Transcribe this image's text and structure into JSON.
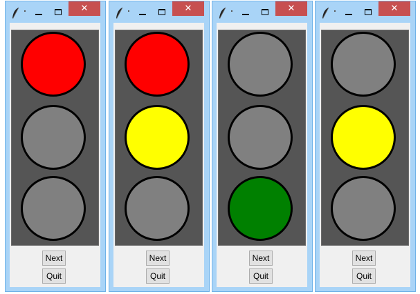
{
  "windows": [
    {
      "close_glyph": "✕",
      "lamps": {
        "red": "#ff0000",
        "yellow": "#808080",
        "green": "#808080"
      },
      "next_label": "Next",
      "quit_label": "Quit"
    },
    {
      "close_glyph": "✕",
      "lamps": {
        "red": "#ff0000",
        "yellow": "#ffff00",
        "green": "#808080"
      },
      "next_label": "Next",
      "quit_label": "Quit"
    },
    {
      "close_glyph": "✕",
      "lamps": {
        "red": "#808080",
        "yellow": "#808080",
        "green": "#008000"
      },
      "next_label": "Next",
      "quit_label": "Quit"
    },
    {
      "close_glyph": "✕",
      "lamps": {
        "red": "#808080",
        "yellow": "#ffff00",
        "green": "#808080"
      },
      "next_label": "Next",
      "quit_label": "Quit"
    }
  ],
  "icons": {
    "app": "feather-icon",
    "minimize": "minimize-icon",
    "maximize": "maximize-icon",
    "close": "close-icon"
  },
  "colors": {
    "title_bar": "#a9d4f7",
    "close_button": "#c75050",
    "canvas": "#555555",
    "off_lamp": "#808080"
  }
}
